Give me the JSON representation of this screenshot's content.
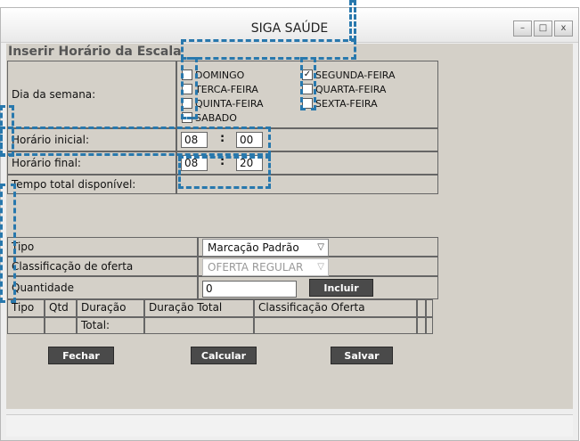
{
  "window": {
    "title": "SIGA SAÚDE",
    "minimize": "–",
    "maximize": "□",
    "close": "x"
  },
  "section_title": "Inserir Horário da Escala",
  "weekday": {
    "label": "Dia da semana:",
    "days": [
      {
        "name": "DOMINGO",
        "checked": false
      },
      {
        "name": "SEGUNDA-FEIRA",
        "checked": true
      },
      {
        "name": "TERCA-FEIRA",
        "checked": false
      },
      {
        "name": "QUARTA-FEIRA",
        "checked": false
      },
      {
        "name": "QUINTA-FEIRA",
        "checked": false
      },
      {
        "name": "SEXTA-FEIRA",
        "checked": false
      },
      {
        "name": "SABADO",
        "checked": false
      }
    ]
  },
  "start_time": {
    "label": "Horário inicial:",
    "hour": "08",
    "minute": "00"
  },
  "end_time": {
    "label": "Horário final:",
    "hour": "08",
    "minute": "20"
  },
  "total_time": {
    "label": "Tempo total disponível:",
    "value": ""
  },
  "tipo": {
    "label": "Tipo",
    "value": "Marcação Padrão"
  },
  "classificacao": {
    "label": "Classificação de oferta",
    "value": "OFERTA REGULAR"
  },
  "quantidade": {
    "label": "Quantidade",
    "value": "0",
    "button": "Incluir"
  },
  "grid": {
    "headers": [
      "Tipo",
      "Qtd",
      "Duração",
      "Duração Total",
      "Classificação Oferta"
    ],
    "total_label": "Total:"
  },
  "buttons": {
    "close": "Fechar",
    "calculate": "Calcular",
    "save": "Salvar"
  },
  "colors": {
    "highlight": "#2878ad",
    "button": "#4a4a4a",
    "form_bg": "#d4d0c8"
  }
}
